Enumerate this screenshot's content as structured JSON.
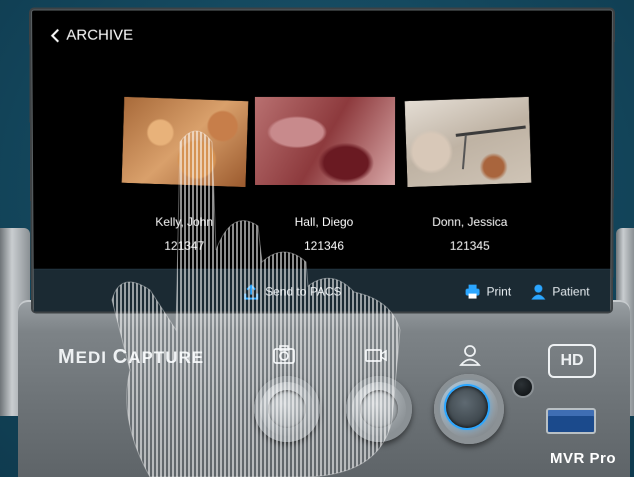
{
  "screen": {
    "back_label": "ARCHIVE",
    "records": [
      {
        "name": "Kelly, John",
        "id": "121347"
      },
      {
        "name": "Hall, Diego",
        "id": "121346"
      },
      {
        "name": "Donn, Jessica",
        "id": "121345"
      }
    ],
    "actions": {
      "send": "Send to PACS",
      "print": "Print",
      "patient": "Patient"
    }
  },
  "device": {
    "brand_m": "M",
    "brand_edi": "EDI ",
    "brand_c": "C",
    "brand_apture": "APTURE",
    "hd_label": "HD",
    "model": "MVR Pro"
  },
  "colors": {
    "accent": "#2ba6ff",
    "screen_bg": "#000000",
    "bar_bg": "#1b2a33",
    "background": "#14485e"
  },
  "icons": [
    "chevron-left-icon",
    "upload-icon",
    "printer-icon",
    "user-icon",
    "camera-icon",
    "video-icon",
    "person-icon",
    "usb-port-icon",
    "hand-gesture"
  ]
}
